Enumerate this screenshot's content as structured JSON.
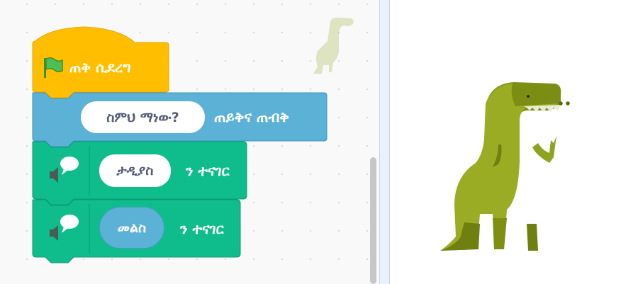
{
  "script": {
    "hat_block": {
      "label": "ጠቅ ሲደረግ",
      "icon": "green-flag-icon"
    },
    "ask_block": {
      "input_value": "ስምህ ማነው?",
      "label": "ጠይቅና ጠብቅ"
    },
    "say_block_1": {
      "input_value": "ታዲያስ",
      "label": "ን ተናገር",
      "icon": "speech-bubble-icon"
    },
    "say_block_2": {
      "reporter_value": "መልስ",
      "label": "ን ተናገር",
      "icon": "speech-bubble-icon"
    }
  },
  "stage": {
    "sprite": "dinosaur-sprite"
  },
  "colors": {
    "events": "#ffbf00",
    "sensing": "#5cb1d6",
    "extension": "#0fbd8c",
    "sprite_green": "#8ea328"
  }
}
